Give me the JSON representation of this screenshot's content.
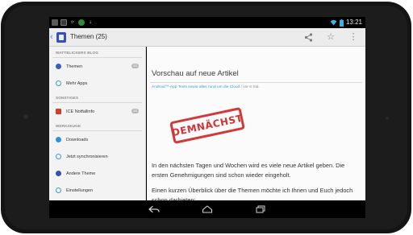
{
  "status_bar": {
    "time": "13:21",
    "notification_icons": [
      "gallery-icon",
      "keyboard-icon",
      "sync-icon",
      "app-icon",
      "download-icon"
    ],
    "status_icons": [
      "wifi-icon",
      "battery-icon"
    ]
  },
  "action_bar": {
    "title": "Themen (25)",
    "actions": [
      "share-icon",
      "star-icon",
      "overflow-menu-icon"
    ]
  },
  "sidebar": {
    "sections": [
      {
        "header": "WATTBLICKERS BLOG",
        "items": [
          {
            "label": "Themen",
            "badge": "25",
            "icon": "themes-icon",
            "color": "#3b5fb8"
          },
          {
            "label": "Mehr Apps",
            "badge": "",
            "icon": "more-apps-icon",
            "color": "#3a9bd5"
          }
        ]
      },
      {
        "header": "SONSTIGES",
        "items": [
          {
            "label": "ICE Notfallinfo",
            "badge": "28",
            "icon": "ice-info-icon",
            "color": "#d43c2c"
          }
        ]
      },
      {
        "header": "WERKZEUGE",
        "items": [
          {
            "label": "Downloads",
            "badge": "",
            "icon": "downloads-icon",
            "color": "#2f8fe0"
          },
          {
            "label": "Jetzt synchronisieren",
            "badge": "",
            "icon": "sync-now-icon",
            "color": "#3a9bd5"
          },
          {
            "label": "Andere Theme",
            "badge": "",
            "icon": "theme-icon",
            "color": "#3b4fb0"
          },
          {
            "label": "Einstellungen",
            "badge": "",
            "icon": "settings-icon",
            "color": "#3a9bd5"
          }
        ]
      }
    ]
  },
  "post": {
    "title": "Vorschau auf neue Artikel",
    "category": "Android™-App Texts sowie alles rund um die Cloud",
    "byline": "/ vor 6 Std.",
    "stamp": "DEMNÄCHST",
    "paragraph1": "In den nächsten Tagen und Wochen wird es viele neue Artikel geben. Die ersten Genehmigungen sind schon wieder eingeholt.",
    "paragraph2": "Einen kurzen Überblick über die Themen möchte ich Ihnen und Euch jedoch schon darbieten:"
  },
  "nav_bar": [
    "back-icon",
    "home-icon",
    "recents-icon"
  ],
  "colors": {
    "accent": "#3a9bd5",
    "stamp_red": "#d23a3a",
    "bezel": "#141414"
  }
}
